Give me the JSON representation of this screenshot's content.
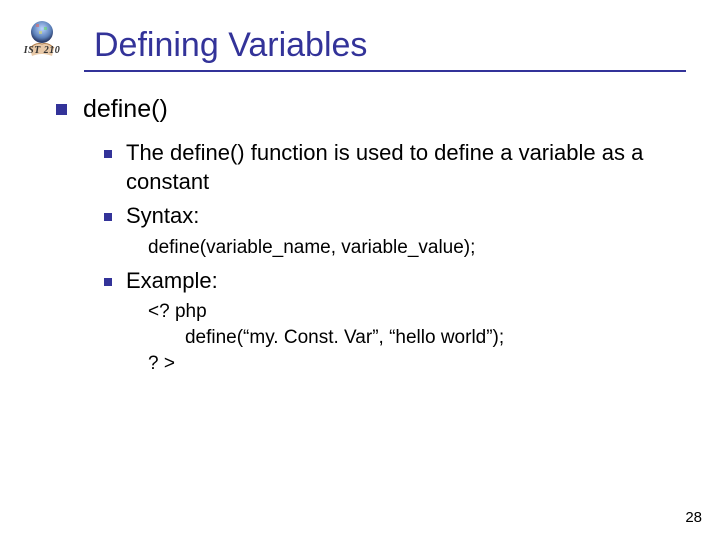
{
  "course_code": "IST 210",
  "slide_title": "Defining Variables",
  "page_number": "28",
  "b1_label": "define()",
  "b2a_text": "The define() function is used to define a variable as a constant",
  "b2b_text": "Syntax:",
  "syntax_line": "define(variable_name, variable_value);",
  "b2c_text": "Example:",
  "code_line1": "<? php",
  "code_line2": "       define(“my. Const. Var”, “hello world”);",
  "code_line3": "? >",
  "chart_data": {
    "type": "table",
    "title": "Defining Variables — define() slide outline",
    "rows": [
      {
        "level": 1,
        "text": "define()"
      },
      {
        "level": 2,
        "text": "The define() function is used to define a variable as a constant"
      },
      {
        "level": 2,
        "text": "Syntax:"
      },
      {
        "level": 3,
        "text": "define(variable_name, variable_value);"
      },
      {
        "level": 2,
        "text": "Example:"
      },
      {
        "level": 3,
        "text": "<? php"
      },
      {
        "level": 3,
        "text": "       define(“my. Const. Var”, “hello world”);"
      },
      {
        "level": 3,
        "text": "? >"
      }
    ]
  }
}
